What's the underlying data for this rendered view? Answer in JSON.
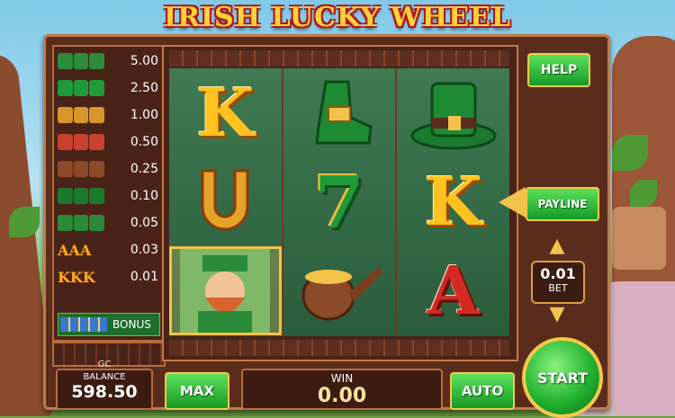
{
  "title": "IRISH LUCKY WHEEL",
  "paytable": {
    "rows": [
      {
        "symbol": "leprechaun-x3",
        "value": "5.00"
      },
      {
        "symbol": "seven-x3",
        "value": "2.50"
      },
      {
        "symbol": "horseshoe-x3",
        "value": "1.00"
      },
      {
        "symbol": "mushroom-x3",
        "value": "0.50"
      },
      {
        "symbol": "pipe-x3",
        "value": "0.25"
      },
      {
        "symbol": "hat-x3",
        "value": "0.10"
      },
      {
        "symbol": "boot-x3",
        "value": "0.05"
      },
      {
        "symbol": "AAA",
        "value": "0.03"
      },
      {
        "symbol": "KKK",
        "value": "0.01"
      }
    ],
    "letter_symbols": {
      "a": "AAA",
      "k": "KKK"
    },
    "bonus_label": "BONUS"
  },
  "reels": [
    [
      "K",
      "horseshoe",
      "leprechaun"
    ],
    [
      "boot",
      "7",
      "pipe"
    ],
    [
      "hat",
      "K",
      "A"
    ]
  ],
  "reel_letters": {
    "k": "K",
    "seven": "7",
    "a": "A"
  },
  "buttons": {
    "help": "HELP",
    "payline": "PAYLINE",
    "max": "MAX",
    "auto": "AUTO",
    "start": "START"
  },
  "bet": {
    "value": "0.01",
    "label": "BET"
  },
  "balance": {
    "currency": "GC",
    "label": "BALANCE",
    "value": "598.50"
  },
  "win": {
    "label": "WIN",
    "value": "0.00"
  },
  "colors": {
    "accent": "#f1c34b",
    "button": "#169a27",
    "wood": "#5a2c1c"
  }
}
